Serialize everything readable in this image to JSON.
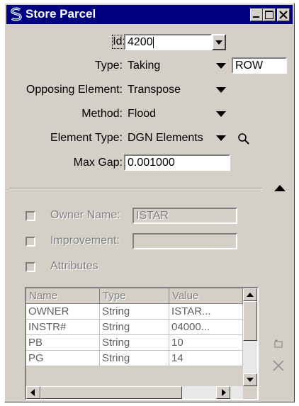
{
  "window": {
    "title": "Store Parcel"
  },
  "form": {
    "id_label": "Id:",
    "id_value": "4200",
    "type_label": "Type:",
    "type_value": "Taking",
    "type_extra": "ROW",
    "opposing_label": "Opposing Element:",
    "opposing_value": "Transpose",
    "method_label": "Method:",
    "method_value": "Flood",
    "element_type_label": "Element Type:",
    "element_type_value": "DGN Elements",
    "max_gap_label": "Max Gap:",
    "max_gap_value": "0.001000"
  },
  "options": {
    "owner_label": "Owner Name:",
    "owner_value": "ISTAR",
    "owner_checked": false,
    "improvement_label": "Improvement:",
    "improvement_value": "",
    "improvement_checked": false,
    "attributes_label": "Attributes",
    "attributes_checked": false
  },
  "table": {
    "columns": [
      "Name",
      "Type",
      "Value"
    ],
    "rows": [
      [
        "OWNER",
        "String",
        "ISTAR..."
      ],
      [
        "INSTR#",
        "String",
        "04000..."
      ],
      [
        "PB",
        "String",
        "10"
      ],
      [
        "PG",
        "String",
        "14"
      ]
    ]
  },
  "icons": {
    "app": "app-s-icon",
    "search": "magnifier-icon",
    "collapse": "triangle-up-icon",
    "add": "add-row-icon",
    "delete": "delete-x-icon"
  }
}
